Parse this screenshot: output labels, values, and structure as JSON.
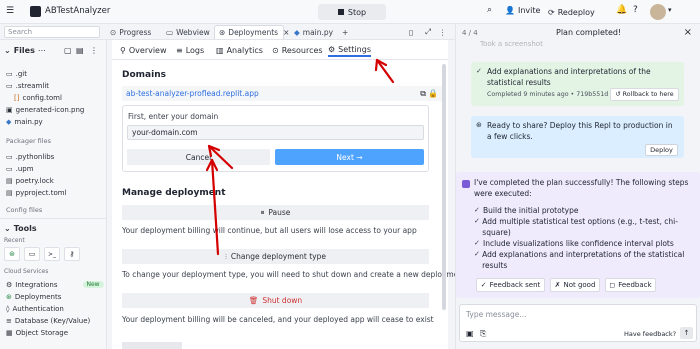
{
  "app": {
    "title": "ABTestAnalyzer",
    "logo": "replit-logo"
  },
  "topbar": {
    "stop_label": "Stop",
    "invite_label": "Invite",
    "redeploy_label": "Redeploy"
  },
  "tabs": [
    {
      "label": "Progress"
    },
    {
      "label": "Webview"
    },
    {
      "label": "Deployments"
    },
    {
      "label": "main.py"
    }
  ],
  "left": {
    "search_placeholder": "Search",
    "files_title": "Files",
    "files": [
      ".git",
      ".streamlit",
      "config.toml",
      "generated-icon.png",
      "main.py"
    ],
    "packager_title": "Packager files",
    "packager_files": [
      ".pythonlibs",
      ".upm",
      "poetry.lock",
      "pyproject.toml"
    ],
    "config_title": "Config files",
    "tools_title": "Tools",
    "recent_title": "Recent",
    "cloud_title": "Cloud Services",
    "cloud": [
      "Integrations",
      "Deployments",
      "Authentication",
      "Database (Key/Value)",
      "Object Storage"
    ],
    "new_badge": "New"
  },
  "subtabs": [
    "Overview",
    "Logs",
    "Analytics",
    "Resources",
    "Settings"
  ],
  "domains": {
    "title": "Domains",
    "url": "ab-test-analyzer-proflead.replit.app",
    "prompt": "First, enter your domain",
    "input_value": "your-domain.com",
    "cancel": "Cancel",
    "next": "Next →"
  },
  "manage": {
    "title": "Manage deployment",
    "pause": "Pause",
    "pause_desc": "Your deployment billing will continue, but all users will lose access to your app",
    "change": "Change deployment type",
    "change_desc": "To change your deployment type, you will need to shut down and create a new deployment",
    "shutdown": "Shut down",
    "shutdown_desc": "Your deployment billing will be canceled, and your deployed app will cease to exist"
  },
  "chat": {
    "step": "4 / 4",
    "header": "Plan completed!",
    "faded": "Took a screenshot",
    "explain": "Add explanations and interpretations of the statistical results",
    "meta": "Completed 9 minutes ago • 719b551d",
    "rollback": "Rollback to here",
    "share": "Ready to share? Deploy this Repl to production in a few clicks.",
    "deploy": "Deploy",
    "intro": "I've completed the plan successfully! The following steps were executed:",
    "steps": [
      "Build the initial prototype",
      "Add multiple statistical test options (e.g., t-test, chi-square)",
      "Include visualizations like confidence interval plots",
      "Add explanations and interpretations of the statistical results"
    ],
    "feedback_sent": "Feedback sent",
    "not_good": "Not good",
    "feedback": "Feedback",
    "placeholder": "Type message...",
    "have_feedback": "Have feedback?"
  },
  "colors": {
    "accent": "#2f6fe0",
    "next_btn": "#4ea3ff",
    "success_bg": "#e3f4e5",
    "info_bg": "#dbeeff",
    "chat_bg": "#efeafc",
    "annotation": "#d40000"
  }
}
